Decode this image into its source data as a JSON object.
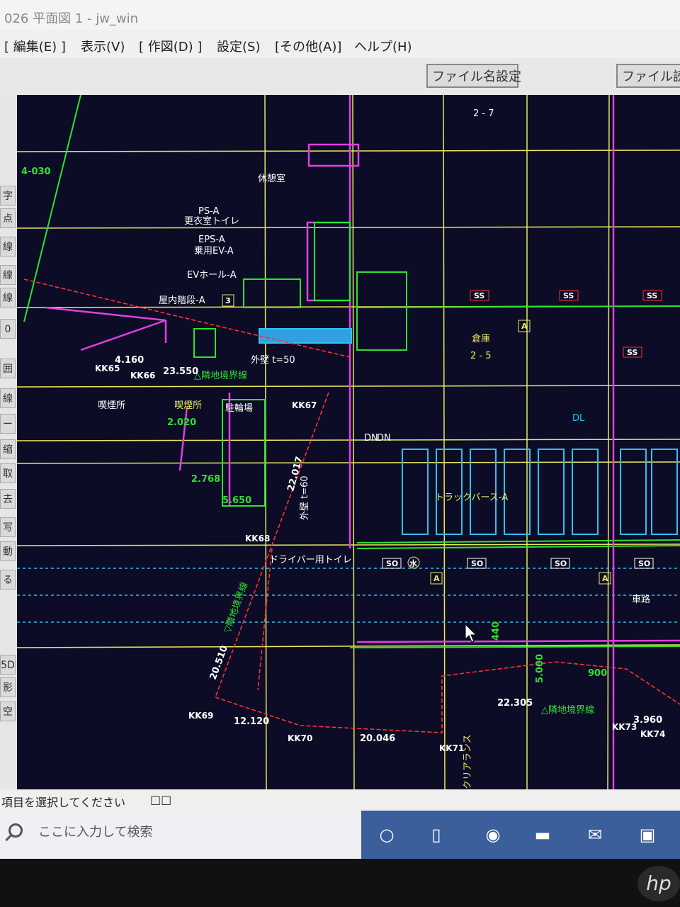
{
  "window": {
    "title": "026 平面図 1 - jw_win"
  },
  "menu": [
    {
      "label": "[ 編集(E) ]"
    },
    {
      "label": "表示(V)"
    },
    {
      "label": "[ 作図(D) ]"
    },
    {
      "label": "設定(S)"
    },
    {
      "label": "[その他(A)]"
    },
    {
      "label": "ヘルプ(H)"
    }
  ],
  "toolbar": {
    "file_name_setting": "ファイル名設定",
    "file_read": "ファイル読"
  },
  "left_tools": [
    "字",
    "点",
    "線",
    "線",
    "線",
    "0",
    "囲",
    "線",
    "ー",
    "縮",
    "取",
    "去",
    "写",
    "動",
    "る",
    "5D",
    "影",
    "空"
  ],
  "drawing": {
    "labels": {
      "smoking_area": "喫煙所",
      "smoking_area2": "喫煙所",
      "bike_parking": "駐輪場",
      "outer_wall_50": "外壁 t=50",
      "outer_wall_60": "外壁 t=60",
      "boundary1": "△隣地境界線",
      "boundary2": "△隣地境界線",
      "boundary3": "▽隣地境界線",
      "driver_toilet": "ドライバー用トイレ",
      "truck_berth": "トラックバース-A",
      "warehouse": "倉庫",
      "warehouse_no": "2 - 5",
      "road": "車路",
      "indoor_stairs": "屋内階段-A",
      "ev_hall": "EVホール-A",
      "ev_shared": "乗用EV-A",
      "eps": "EPS-A",
      "toilet": "更衣室トイレ",
      "ps": "PS-A",
      "lounge": "休憩室",
      "clearance": "クリアランス",
      "dl": "DL",
      "dn1": "DN",
      "dn2": "DN",
      "room_no_top": "2 - 7"
    },
    "dims": {
      "d4160": "4.160",
      "d23550": "23.550",
      "d2020": "2.020",
      "d2768": "2.768",
      "d5650": "5.650",
      "d22017": "22.017",
      "d20510": "20.510",
      "d12120": "12.120",
      "d20046": "20.046",
      "d22305": "22.305",
      "d5000": "5.000",
      "d3960": "3.960",
      "d900": "900",
      "d440": "440",
      "d4030": "4-030"
    },
    "points": {
      "kk65": "KK65",
      "kk66": "KK66",
      "kk67": "KK67",
      "kk68": "KK68",
      "kk69": "KK69",
      "kk70": "KK70",
      "kk71": "KK71",
      "kk73": "KK73",
      "kk74": "KK74"
    },
    "tags": {
      "ss": "SS",
      "so": "SO",
      "a": "A",
      "water": "水",
      "rk3": "3"
    }
  },
  "status": {
    "message": "項目を選択してください",
    "squares": "□□"
  },
  "taskbar": {
    "search_placeholder": "ここに入力して検索"
  },
  "colors": {
    "canvas": "#0c0c26",
    "yellow": "#e8e860",
    "magenta": "#e040e0",
    "red": "#ff3030",
    "green": "#30e030",
    "cyan": "#30c0f0",
    "white": "#ffffff"
  }
}
